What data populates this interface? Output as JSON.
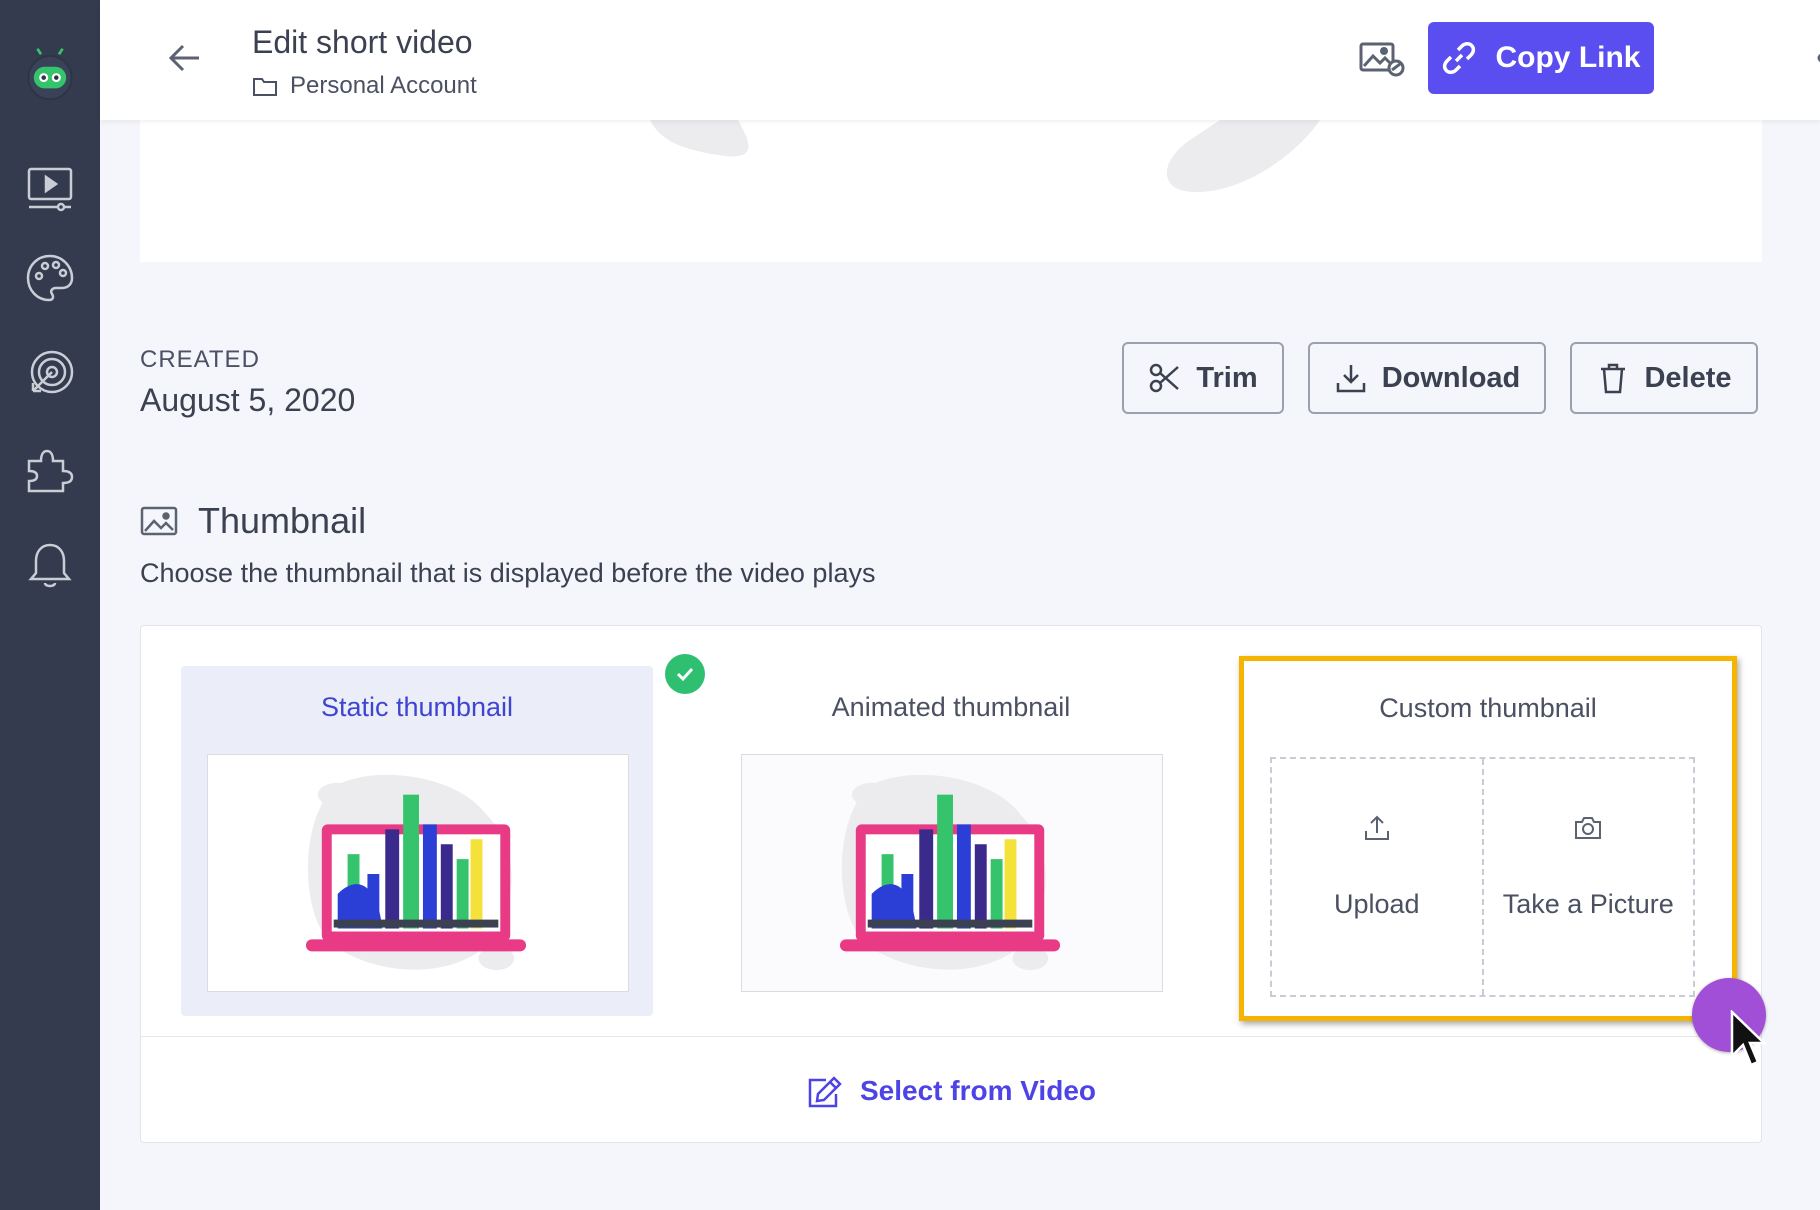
{
  "header": {
    "title": "Edit short video",
    "breadcrumb": "Personal Account",
    "copy_link_label": "Copy Link"
  },
  "sidebar": {
    "items": [
      {
        "name": "logo",
        "icon": "robot-logo-icon"
      },
      {
        "name": "videos",
        "icon": "video-library-icon"
      },
      {
        "name": "branding",
        "icon": "palette-icon"
      },
      {
        "name": "targeting",
        "icon": "target-icon"
      },
      {
        "name": "integrations",
        "icon": "puzzle-icon"
      },
      {
        "name": "notifications",
        "icon": "bell-icon"
      }
    ]
  },
  "created": {
    "label": "CREATED",
    "date": "August 5, 2020"
  },
  "actions": {
    "trim": "Trim",
    "download": "Download",
    "delete": "Delete"
  },
  "thumbnail": {
    "title": "Thumbnail",
    "description": "Choose the thumbnail that is displayed before the video plays",
    "options": {
      "static": "Static thumbnail",
      "animated": "Animated thumbnail",
      "custom": "Custom thumbnail"
    },
    "selected": "static",
    "upload_label": "Upload",
    "take_picture_label": "Take a Picture",
    "select_from_video": "Select from Video"
  },
  "colors": {
    "sidebar": "#343b4e",
    "accent": "#5b4ef0",
    "selected_label": "#3f45d0",
    "highlight": "#f5b400",
    "check": "#2fbf71",
    "cursor": "#a14fd6"
  }
}
